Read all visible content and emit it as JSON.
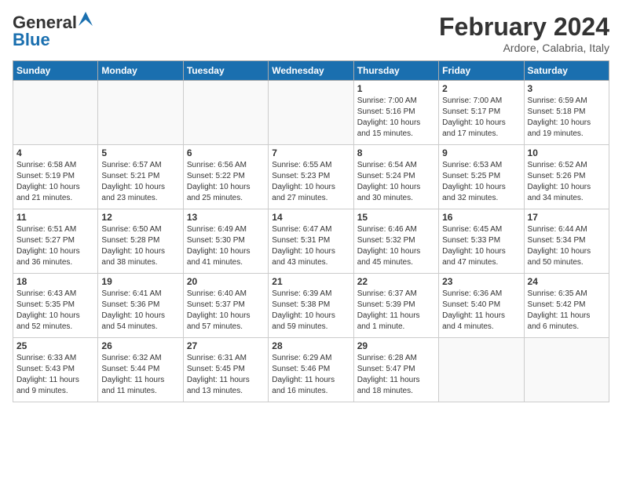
{
  "header": {
    "logo_line1": "General",
    "logo_line2": "Blue",
    "title": "February 2024",
    "location": "Ardore, Calabria, Italy"
  },
  "weekdays": [
    "Sunday",
    "Monday",
    "Tuesday",
    "Wednesday",
    "Thursday",
    "Friday",
    "Saturday"
  ],
  "weeks": [
    [
      {
        "day": "",
        "info": ""
      },
      {
        "day": "",
        "info": ""
      },
      {
        "day": "",
        "info": ""
      },
      {
        "day": "",
        "info": ""
      },
      {
        "day": "1",
        "info": "Sunrise: 7:00 AM\nSunset: 5:16 PM\nDaylight: 10 hours\nand 15 minutes."
      },
      {
        "day": "2",
        "info": "Sunrise: 7:00 AM\nSunset: 5:17 PM\nDaylight: 10 hours\nand 17 minutes."
      },
      {
        "day": "3",
        "info": "Sunrise: 6:59 AM\nSunset: 5:18 PM\nDaylight: 10 hours\nand 19 minutes."
      }
    ],
    [
      {
        "day": "4",
        "info": "Sunrise: 6:58 AM\nSunset: 5:19 PM\nDaylight: 10 hours\nand 21 minutes."
      },
      {
        "day": "5",
        "info": "Sunrise: 6:57 AM\nSunset: 5:21 PM\nDaylight: 10 hours\nand 23 minutes."
      },
      {
        "day": "6",
        "info": "Sunrise: 6:56 AM\nSunset: 5:22 PM\nDaylight: 10 hours\nand 25 minutes."
      },
      {
        "day": "7",
        "info": "Sunrise: 6:55 AM\nSunset: 5:23 PM\nDaylight: 10 hours\nand 27 minutes."
      },
      {
        "day": "8",
        "info": "Sunrise: 6:54 AM\nSunset: 5:24 PM\nDaylight: 10 hours\nand 30 minutes."
      },
      {
        "day": "9",
        "info": "Sunrise: 6:53 AM\nSunset: 5:25 PM\nDaylight: 10 hours\nand 32 minutes."
      },
      {
        "day": "10",
        "info": "Sunrise: 6:52 AM\nSunset: 5:26 PM\nDaylight: 10 hours\nand 34 minutes."
      }
    ],
    [
      {
        "day": "11",
        "info": "Sunrise: 6:51 AM\nSunset: 5:27 PM\nDaylight: 10 hours\nand 36 minutes."
      },
      {
        "day": "12",
        "info": "Sunrise: 6:50 AM\nSunset: 5:28 PM\nDaylight: 10 hours\nand 38 minutes."
      },
      {
        "day": "13",
        "info": "Sunrise: 6:49 AM\nSunset: 5:30 PM\nDaylight: 10 hours\nand 41 minutes."
      },
      {
        "day": "14",
        "info": "Sunrise: 6:47 AM\nSunset: 5:31 PM\nDaylight: 10 hours\nand 43 minutes."
      },
      {
        "day": "15",
        "info": "Sunrise: 6:46 AM\nSunset: 5:32 PM\nDaylight: 10 hours\nand 45 minutes."
      },
      {
        "day": "16",
        "info": "Sunrise: 6:45 AM\nSunset: 5:33 PM\nDaylight: 10 hours\nand 47 minutes."
      },
      {
        "day": "17",
        "info": "Sunrise: 6:44 AM\nSunset: 5:34 PM\nDaylight: 10 hours\nand 50 minutes."
      }
    ],
    [
      {
        "day": "18",
        "info": "Sunrise: 6:43 AM\nSunset: 5:35 PM\nDaylight: 10 hours\nand 52 minutes."
      },
      {
        "day": "19",
        "info": "Sunrise: 6:41 AM\nSunset: 5:36 PM\nDaylight: 10 hours\nand 54 minutes."
      },
      {
        "day": "20",
        "info": "Sunrise: 6:40 AM\nSunset: 5:37 PM\nDaylight: 10 hours\nand 57 minutes."
      },
      {
        "day": "21",
        "info": "Sunrise: 6:39 AM\nSunset: 5:38 PM\nDaylight: 10 hours\nand 59 minutes."
      },
      {
        "day": "22",
        "info": "Sunrise: 6:37 AM\nSunset: 5:39 PM\nDaylight: 11 hours\nand 1 minute."
      },
      {
        "day": "23",
        "info": "Sunrise: 6:36 AM\nSunset: 5:40 PM\nDaylight: 11 hours\nand 4 minutes."
      },
      {
        "day": "24",
        "info": "Sunrise: 6:35 AM\nSunset: 5:42 PM\nDaylight: 11 hours\nand 6 minutes."
      }
    ],
    [
      {
        "day": "25",
        "info": "Sunrise: 6:33 AM\nSunset: 5:43 PM\nDaylight: 11 hours\nand 9 minutes."
      },
      {
        "day": "26",
        "info": "Sunrise: 6:32 AM\nSunset: 5:44 PM\nDaylight: 11 hours\nand 11 minutes."
      },
      {
        "day": "27",
        "info": "Sunrise: 6:31 AM\nSunset: 5:45 PM\nDaylight: 11 hours\nand 13 minutes."
      },
      {
        "day": "28",
        "info": "Sunrise: 6:29 AM\nSunset: 5:46 PM\nDaylight: 11 hours\nand 16 minutes."
      },
      {
        "day": "29",
        "info": "Sunrise: 6:28 AM\nSunset: 5:47 PM\nDaylight: 11 hours\nand 18 minutes."
      },
      {
        "day": "",
        "info": ""
      },
      {
        "day": "",
        "info": ""
      }
    ]
  ]
}
